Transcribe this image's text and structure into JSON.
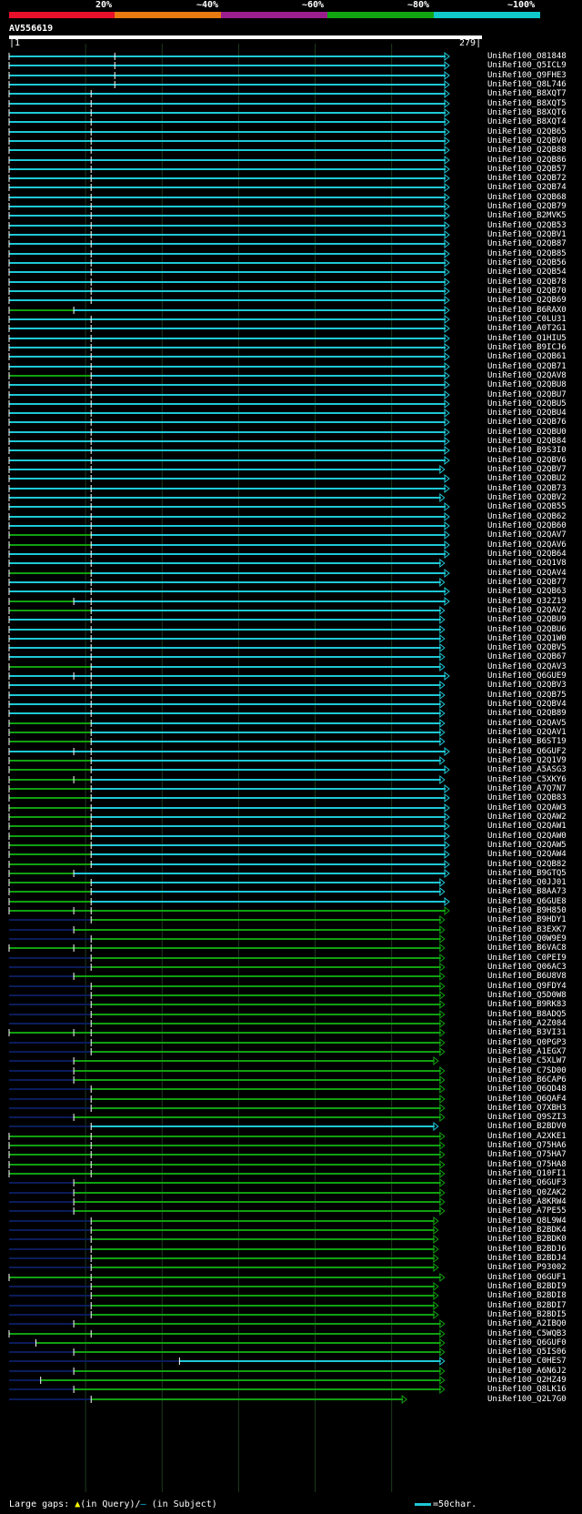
{
  "legend": {
    "labels": [
      "20%",
      "~40%",
      "~60%",
      "~80%",
      "~100%"
    ],
    "colors": [
      "#e8102a",
      "#e87a10",
      "#9b1e8e",
      "#12a512",
      "#10c8c8"
    ]
  },
  "query": {
    "id": "AV556619",
    "start": "1",
    "end": "279"
  },
  "colors": {
    "cyan": "#1ec8d6",
    "green": "#10a010",
    "navy": "#0b1c5a",
    "white": "#ffffff",
    "grid": "#1e3a1e"
  },
  "hits": [
    {
      "id": "UniRef100_O81848",
      "s": 0,
      "e": 279,
      "c": "c",
      "m": [
        67
      ]
    },
    {
      "id": "UniRef100_Q5ICL9",
      "s": 0,
      "e": 279,
      "c": "c",
      "m": [
        67
      ]
    },
    {
      "id": "UniRef100_Q9FHE3",
      "s": 0,
      "e": 279,
      "c": "c",
      "m": [
        67
      ]
    },
    {
      "id": "UniRef100_Q8L746",
      "s": 0,
      "e": 279,
      "c": "c",
      "m": [
        67
      ]
    },
    {
      "id": "UniRef100_B8XQT7",
      "s": 0,
      "e": 279,
      "c": "c",
      "m": [
        52
      ]
    },
    {
      "id": "UniRef100_B8XQT5",
      "s": 0,
      "e": 279,
      "c": "c",
      "m": [
        52
      ]
    },
    {
      "id": "UniRef100_B8XQT6",
      "s": 0,
      "e": 279,
      "c": "c",
      "m": [
        52
      ]
    },
    {
      "id": "UniRef100_B8XQT4",
      "s": 0,
      "e": 279,
      "c": "c",
      "m": [
        52
      ]
    },
    {
      "id": "UniRef100_Q2QB65",
      "s": 0,
      "e": 279,
      "c": "c",
      "m": [
        52
      ]
    },
    {
      "id": "UniRef100_Q2QBV0",
      "s": 0,
      "e": 279,
      "c": "c",
      "m": [
        52
      ]
    },
    {
      "id": "UniRef100_Q2QB88",
      "s": 0,
      "e": 279,
      "c": "c",
      "m": [
        52
      ]
    },
    {
      "id": "UniRef100_Q2QB86",
      "s": 0,
      "e": 279,
      "c": "c",
      "m": [
        52
      ]
    },
    {
      "id": "UniRef100_Q2QB57",
      "s": 0,
      "e": 279,
      "c": "c",
      "m": [
        52
      ]
    },
    {
      "id": "UniRef100_Q2QB72",
      "s": 0,
      "e": 279,
      "c": "c",
      "m": [
        52
      ]
    },
    {
      "id": "UniRef100_Q2QB74",
      "s": 0,
      "e": 279,
      "c": "c",
      "m": [
        52
      ]
    },
    {
      "id": "UniRef100_Q2QB68",
      "s": 0,
      "e": 279,
      "c": "c",
      "m": [
        52
      ]
    },
    {
      "id": "UniRef100_Q2QB79",
      "s": 0,
      "e": 279,
      "c": "c",
      "m": [
        52
      ]
    },
    {
      "id": "UniRef100_B2MVK5",
      "s": 0,
      "e": 279,
      "c": "c",
      "m": [
        52
      ]
    },
    {
      "id": "UniRef100_Q2QB53",
      "s": 0,
      "e": 279,
      "c": "c",
      "m": [
        52
      ]
    },
    {
      "id": "UniRef100_Q2QBV1",
      "s": 0,
      "e": 279,
      "c": "c",
      "m": [
        52
      ]
    },
    {
      "id": "UniRef100_Q2QB87",
      "s": 0,
      "e": 279,
      "c": "c",
      "m": [
        52
      ]
    },
    {
      "id": "UniRef100_Q2QB85",
      "s": 0,
      "e": 279,
      "c": "c",
      "m": [
        52
      ]
    },
    {
      "id": "UniRef100_Q2QB56",
      "s": 0,
      "e": 279,
      "c": "c",
      "m": [
        52
      ]
    },
    {
      "id": "UniRef100_Q2QB54",
      "s": 0,
      "e": 279,
      "c": "c",
      "m": [
        52
      ]
    },
    {
      "id": "UniRef100_Q2QB78",
      "s": 0,
      "e": 279,
      "c": "c",
      "m": [
        52
      ]
    },
    {
      "id": "UniRef100_Q2QB70",
      "s": 0,
      "e": 279,
      "c": "c",
      "m": [
        52
      ]
    },
    {
      "id": "UniRef100_Q2QB69",
      "s": 0,
      "e": 279,
      "c": "c",
      "m": [
        52
      ]
    },
    {
      "id": "UniRef100_B6RAX0",
      "s": 0,
      "e": 279,
      "c": "c",
      "g": 41,
      "m": [
        41
      ]
    },
    {
      "id": "UniRef100_C0LU31",
      "s": 0,
      "e": 279,
      "c": "c",
      "m": [
        52
      ]
    },
    {
      "id": "UniRef100_A0T2G1",
      "s": 0,
      "e": 279,
      "c": "c",
      "m": [
        52
      ]
    },
    {
      "id": "UniRef100_Q1HIU5",
      "s": 0,
      "e": 279,
      "c": "c",
      "m": [
        52
      ]
    },
    {
      "id": "UniRef100_B9ICJ6",
      "s": 0,
      "e": 279,
      "c": "c",
      "m": [
        52
      ]
    },
    {
      "id": "UniRef100_Q2QB61",
      "s": 0,
      "e": 279,
      "c": "c",
      "m": [
        52
      ]
    },
    {
      "id": "UniRef100_Q2QB71",
      "s": 0,
      "e": 279,
      "c": "c",
      "m": [
        52
      ]
    },
    {
      "id": "UniRef100_Q2QAV8",
      "s": 0,
      "e": 279,
      "c": "c",
      "g": 52,
      "m": [
        52
      ]
    },
    {
      "id": "UniRef100_Q2QBU8",
      "s": 0,
      "e": 279,
      "c": "c",
      "m": [
        52
      ]
    },
    {
      "id": "UniRef100_Q2QBU7",
      "s": 0,
      "e": 279,
      "c": "c",
      "m": [
        52
      ]
    },
    {
      "id": "UniRef100_Q2QBU5",
      "s": 0,
      "e": 279,
      "c": "c",
      "m": [
        52
      ]
    },
    {
      "id": "UniRef100_Q2QBU4",
      "s": 0,
      "e": 279,
      "c": "c",
      "m": [
        52
      ]
    },
    {
      "id": "UniRef100_Q2QB76",
      "s": 0,
      "e": 279,
      "c": "c",
      "m": [
        52
      ]
    },
    {
      "id": "UniRef100_Q2QBU0",
      "s": 0,
      "e": 279,
      "c": "c",
      "m": [
        52
      ]
    },
    {
      "id": "UniRef100_Q2QB84",
      "s": 0,
      "e": 279,
      "c": "c",
      "m": [
        52
      ]
    },
    {
      "id": "UniRef100_B9S3I0",
      "s": 0,
      "e": 279,
      "c": "c",
      "m": [
        52
      ]
    },
    {
      "id": "UniRef100_Q2QBV6",
      "s": 0,
      "e": 279,
      "c": "c",
      "m": [
        52
      ]
    },
    {
      "id": "UniRef100_Q2QBV7",
      "s": 0,
      "e": 276,
      "c": "c",
      "m": [
        52
      ]
    },
    {
      "id": "UniRef100_Q2QBU2",
      "s": 0,
      "e": 279,
      "c": "c",
      "m": [
        52
      ]
    },
    {
      "id": "UniRef100_Q2QB73",
      "s": 0,
      "e": 279,
      "c": "c",
      "m": [
        52
      ]
    },
    {
      "id": "UniRef100_Q2QBV2",
      "s": 0,
      "e": 276,
      "c": "c",
      "m": [
        52
      ]
    },
    {
      "id": "UniRef100_Q2QB55",
      "s": 0,
      "e": 279,
      "c": "c",
      "m": [
        52
      ]
    },
    {
      "id": "UniRef100_Q2QB62",
      "s": 0,
      "e": 279,
      "c": "c",
      "m": [
        52
      ]
    },
    {
      "id": "UniRef100_Q2QB60",
      "s": 0,
      "e": 279,
      "c": "c",
      "m": [
        52
      ]
    },
    {
      "id": "UniRef100_Q2QAV7",
      "s": 0,
      "e": 279,
      "c": "c",
      "g": 52,
      "m": [
        52
      ]
    },
    {
      "id": "UniRef100_Q2QAV6",
      "s": 0,
      "e": 279,
      "c": "c",
      "g": 52,
      "m": [
        52
      ]
    },
    {
      "id": "UniRef100_Q2QB64",
      "s": 0,
      "e": 279,
      "c": "c",
      "m": [
        52
      ]
    },
    {
      "id": "UniRef100_Q2Q1V8",
      "s": 0,
      "e": 276,
      "c": "c",
      "m": [
        52
      ]
    },
    {
      "id": "UniRef100_Q2QAV4",
      "s": 0,
      "e": 279,
      "c": "c",
      "g": 52,
      "m": [
        52
      ]
    },
    {
      "id": "UniRef100_Q2QB77",
      "s": 0,
      "e": 276,
      "c": "c",
      "m": [
        52
      ]
    },
    {
      "id": "UniRef100_Q2QB63",
      "s": 0,
      "e": 279,
      "c": "c",
      "m": [
        52
      ]
    },
    {
      "id": "UniRef100_Q32Z19",
      "s": 0,
      "e": 279,
      "c": "c",
      "g": 41,
      "m": [
        41,
        52
      ]
    },
    {
      "id": "UniRef100_Q2QAV2",
      "s": 0,
      "e": 276,
      "c": "c",
      "g": 52,
      "m": [
        52
      ]
    },
    {
      "id": "UniRef100_Q2QBU9",
      "s": 0,
      "e": 276,
      "c": "c",
      "m": [
        52
      ]
    },
    {
      "id": "UniRef100_Q2QBU6",
      "s": 0,
      "e": 276,
      "c": "c",
      "m": [
        52
      ]
    },
    {
      "id": "UniRef100_Q2Q1W0",
      "s": 0,
      "e": 276,
      "c": "c",
      "m": [
        52
      ]
    },
    {
      "id": "UniRef100_Q2QBV5",
      "s": 0,
      "e": 276,
      "c": "c",
      "m": [
        52
      ]
    },
    {
      "id": "UniRef100_Q2QB67",
      "s": 0,
      "e": 276,
      "c": "c",
      "m": [
        52
      ]
    },
    {
      "id": "UniRef100_Q2QAV3",
      "s": 0,
      "e": 276,
      "c": "c",
      "g": 52,
      "m": [
        52
      ]
    },
    {
      "id": "UniRef100_Q6GUE9",
      "s": 0,
      "e": 279,
      "c": "c",
      "m": [
        41,
        52
      ]
    },
    {
      "id": "UniRef100_Q2QBV3",
      "s": 0,
      "e": 276,
      "c": "c",
      "m": [
        52
      ]
    },
    {
      "id": "UniRef100_Q2QB75",
      "s": 0,
      "e": 276,
      "c": "c",
      "m": [
        52
      ]
    },
    {
      "id": "UniRef100_Q2QBV4",
      "s": 0,
      "e": 276,
      "c": "c",
      "m": [
        52
      ]
    },
    {
      "id": "UniRef100_Q2QB89",
      "s": 0,
      "e": 276,
      "c": "c",
      "m": [
        52
      ]
    },
    {
      "id": "UniRef100_Q2QAV5",
      "s": 0,
      "e": 276,
      "c": "c",
      "g": 52,
      "m": [
        52
      ]
    },
    {
      "id": "UniRef100_Q2QAV1",
      "s": 0,
      "e": 276,
      "c": "c",
      "g": 52,
      "m": [
        52
      ]
    },
    {
      "id": "UniRef100_B6ST19",
      "s": 0,
      "e": 276,
      "c": "c",
      "g": 52,
      "m": [
        52
      ]
    },
    {
      "id": "UniRef100_Q6GUF2",
      "s": 0,
      "e": 279,
      "c": "c",
      "m": [
        41,
        52
      ]
    },
    {
      "id": "UniRef100_Q2Q1V9",
      "s": 0,
      "e": 276,
      "c": "c",
      "g": 52,
      "m": [
        52
      ]
    },
    {
      "id": "UniRef100_A5ASG3",
      "s": 0,
      "e": 279,
      "c": "c",
      "g": 52,
      "m": [
        52
      ]
    },
    {
      "id": "UniRef100_C5XKY6",
      "s": 0,
      "e": 276,
      "c": "c",
      "g": 52,
      "m": [
        41,
        52
      ]
    },
    {
      "id": "UniRef100_A7Q7N7",
      "s": 0,
      "e": 279,
      "c": "c",
      "g": 52,
      "m": [
        52
      ]
    },
    {
      "id": "UniRef100_Q2QB83",
      "s": 0,
      "e": 279,
      "c": "c",
      "g": 52,
      "m": [
        52
      ]
    },
    {
      "id": "UniRef100_Q2QAW3",
      "s": 0,
      "e": 279,
      "c": "c",
      "g": 52,
      "m": [
        52
      ]
    },
    {
      "id": "UniRef100_Q2QAW2",
      "s": 0,
      "e": 279,
      "c": "c",
      "g": 52,
      "m": [
        52
      ]
    },
    {
      "id": "UniRef100_Q2QAW1",
      "s": 0,
      "e": 279,
      "c": "c",
      "g": 52,
      "m": [
        52
      ]
    },
    {
      "id": "UniRef100_Q2QAW0",
      "s": 0,
      "e": 279,
      "c": "c",
      "g": 52,
      "m": [
        52
      ]
    },
    {
      "id": "UniRef100_Q2QAW5",
      "s": 0,
      "e": 279,
      "c": "c",
      "g": 52,
      "m": [
        52
      ]
    },
    {
      "id": "UniRef100_Q2QAW4",
      "s": 0,
      "e": 279,
      "c": "c",
      "g": 52,
      "m": [
        52
      ]
    },
    {
      "id": "UniRef100_Q2QB82",
      "s": 0,
      "e": 279,
      "c": "c",
      "g": 52,
      "m": [
        52
      ]
    },
    {
      "id": "UniRef100_B9GTQ5",
      "s": 0,
      "e": 279,
      "c": "c",
      "g": 41,
      "m": [
        41
      ]
    },
    {
      "id": "UniRef100_Q0JJ01",
      "s": 0,
      "e": 276,
      "c": "c",
      "g": 52,
      "m": [
        52
      ]
    },
    {
      "id": "UniRef100_B8AA73",
      "s": 0,
      "e": 276,
      "c": "c",
      "g": 52,
      "m": [
        52
      ]
    },
    {
      "id": "UniRef100_Q6GUE8",
      "s": 0,
      "e": 279,
      "c": "c",
      "g": 52,
      "m": [
        52
      ]
    },
    {
      "id": "UniRef100_B9H850",
      "s": 0,
      "e": 279,
      "c": "g",
      "m": [
        41,
        52
      ]
    },
    {
      "id": "UniRef100_B9HDY1",
      "s": 52,
      "e": 276,
      "c": "g",
      "n": 52
    },
    {
      "id": "UniRef100_B3EXK7",
      "s": 41,
      "e": 276,
      "c": "g",
      "n": 41
    },
    {
      "id": "UniRef100_Q0W9E9",
      "s": 52,
      "e": 276,
      "c": "g",
      "n": 52
    },
    {
      "id": "UniRef100_B6VAC8",
      "s": 0,
      "e": 276,
      "c": "g",
      "m": [
        41,
        52
      ]
    },
    {
      "id": "UniRef100_C0PEI9",
      "s": 52,
      "e": 276,
      "c": "g",
      "n": 52
    },
    {
      "id": "UniRef100_Q06AC3",
      "s": 52,
      "e": 276,
      "c": "g",
      "n": 52
    },
    {
      "id": "UniRef100_B6U8V8",
      "s": 41,
      "e": 276,
      "c": "g",
      "n": 41
    },
    {
      "id": "UniRef100_Q9FDY4",
      "s": 52,
      "e": 276,
      "c": "g",
      "n": 52
    },
    {
      "id": "UniRef100_Q5D0W8",
      "s": 52,
      "e": 276,
      "c": "g",
      "n": 52
    },
    {
      "id": "UniRef100_B9RK83",
      "s": 52,
      "e": 276,
      "c": "g",
      "n": 52
    },
    {
      "id": "UniRef100_B8ADQ5",
      "s": 52,
      "e": 276,
      "c": "g",
      "n": 52
    },
    {
      "id": "UniRef100_A2Z084",
      "s": 52,
      "e": 276,
      "c": "g",
      "n": 52
    },
    {
      "id": "UniRef100_B3VI31",
      "s": 0,
      "e": 276,
      "c": "g",
      "m": [
        41,
        52
      ]
    },
    {
      "id": "UniRef100_Q0PGP3",
      "s": 52,
      "e": 276,
      "c": "g",
      "n": 52
    },
    {
      "id": "UniRef100_A1EGX7",
      "s": 52,
      "e": 276,
      "c": "g",
      "n": 52
    },
    {
      "id": "UniRef100_C5XLW7",
      "s": 41,
      "e": 272,
      "c": "g",
      "n": 41
    },
    {
      "id": "UniRef100_C7SD00",
      "s": 41,
      "e": 276,
      "c": "g",
      "n": 41
    },
    {
      "id": "UniRef100_B6CAP6",
      "s": 41,
      "e": 276,
      "c": "g",
      "n": 41
    },
    {
      "id": "UniRef100_Q6QD48",
      "s": 52,
      "e": 276,
      "c": "g",
      "n": 52
    },
    {
      "id": "UniRef100_Q6QAF4",
      "s": 52,
      "e": 276,
      "c": "g",
      "n": 52
    },
    {
      "id": "UniRef100_Q7XBH3",
      "s": 52,
      "e": 276,
      "c": "g",
      "n": 52
    },
    {
      "id": "UniRef100_Q9SZI3",
      "s": 41,
      "e": 276,
      "c": "g",
      "n": 41
    },
    {
      "id": "UniRef100_B2BDV0",
      "s": 52,
      "e": 272,
      "c": "c",
      "n": 52
    },
    {
      "id": "UniRef100_A2XKE1",
      "s": 0,
      "e": 276,
      "c": "g",
      "m": [
        52
      ]
    },
    {
      "id": "UniRef100_Q75HA6",
      "s": 0,
      "e": 276,
      "c": "g",
      "m": [
        52
      ]
    },
    {
      "id": "UniRef100_Q75HA7",
      "s": 0,
      "e": 276,
      "c": "g",
      "m": [
        52
      ]
    },
    {
      "id": "UniRef100_Q75HA8",
      "s": 0,
      "e": 276,
      "c": "g",
      "m": [
        52
      ]
    },
    {
      "id": "UniRef100_Q10FI1",
      "s": 0,
      "e": 276,
      "c": "g",
      "m": [
        52
      ]
    },
    {
      "id": "UniRef100_Q6GUF3",
      "s": 41,
      "e": 276,
      "c": "g",
      "n": 41
    },
    {
      "id": "UniRef100_Q0ZAK2",
      "s": 41,
      "e": 276,
      "c": "g",
      "n": 41
    },
    {
      "id": "UniRef100_A8KRW4",
      "s": 41,
      "e": 276,
      "c": "g",
      "n": 41
    },
    {
      "id": "UniRef100_A7PE55",
      "s": 41,
      "e": 276,
      "c": "g",
      "n": 41
    },
    {
      "id": "UniRef100_Q8L9W4",
      "s": 52,
      "e": 272,
      "c": "g",
      "n": 52
    },
    {
      "id": "UniRef100_B2BDK4",
      "s": 52,
      "e": 272,
      "c": "g",
      "n": 52
    },
    {
      "id": "UniRef100_B2BDK0",
      "s": 52,
      "e": 272,
      "c": "g",
      "n": 52
    },
    {
      "id": "UniRef100_B2BDJ6",
      "s": 52,
      "e": 272,
      "c": "g",
      "n": 52
    },
    {
      "id": "UniRef100_B2BDJ4",
      "s": 52,
      "e": 272,
      "c": "g",
      "n": 52
    },
    {
      "id": "UniRef100_P93002",
      "s": 52,
      "e": 272,
      "c": "g",
      "n": 52
    },
    {
      "id": "UniRef100_Q6GUF1",
      "s": 0,
      "e": 276,
      "c": "g",
      "m": [
        52
      ]
    },
    {
      "id": "UniRef100_B2BDI9",
      "s": 52,
      "e": 272,
      "c": "g",
      "n": 52
    },
    {
      "id": "UniRef100_B2BDI8",
      "s": 52,
      "e": 272,
      "c": "g",
      "n": 52
    },
    {
      "id": "UniRef100_B2BDI7",
      "s": 52,
      "e": 272,
      "c": "g",
      "n": 52
    },
    {
      "id": "UniRef100_B2BDI5",
      "s": 52,
      "e": 272,
      "c": "g",
      "n": 52
    },
    {
      "id": "UniRef100_A2IBQ0",
      "s": 41,
      "e": 276,
      "c": "g",
      "n": 41
    },
    {
      "id": "UniRef100_C5WQB3",
      "s": 0,
      "e": 276,
      "c": "g",
      "m": [
        52
      ]
    },
    {
      "id": "UniRef100_Q6GUF0",
      "s": 17,
      "e": 276,
      "c": "g",
      "n": 17
    },
    {
      "id": "UniRef100_Q5IS06",
      "s": 41,
      "e": 276,
      "c": "g",
      "n": 41
    },
    {
      "id": "UniRef100_C0HES7",
      "s": 108,
      "e": 276,
      "c": "c",
      "n": 108
    },
    {
      "id": "UniRef100_A6N6J2",
      "s": 41,
      "e": 276,
      "c": "g",
      "n": 41
    },
    {
      "id": "UniRef100_Q2HZ49",
      "s": 20,
      "e": 276,
      "c": "g",
      "n": 20
    },
    {
      "id": "UniRef100_Q8LK16",
      "s": 41,
      "e": 276,
      "c": "g",
      "n": 41
    },
    {
      "id": "UniRef100_Q2L7G0",
      "s": 52,
      "e": 252,
      "c": "g",
      "n": 52
    }
  ],
  "footer": {
    "gaps_label": "Large gaps:",
    "query_marker": "▲",
    "query_text": "(in Query)/",
    "subject_marker": "—",
    "subject_text": " (in Subject)",
    "scale_text": "=50char."
  }
}
